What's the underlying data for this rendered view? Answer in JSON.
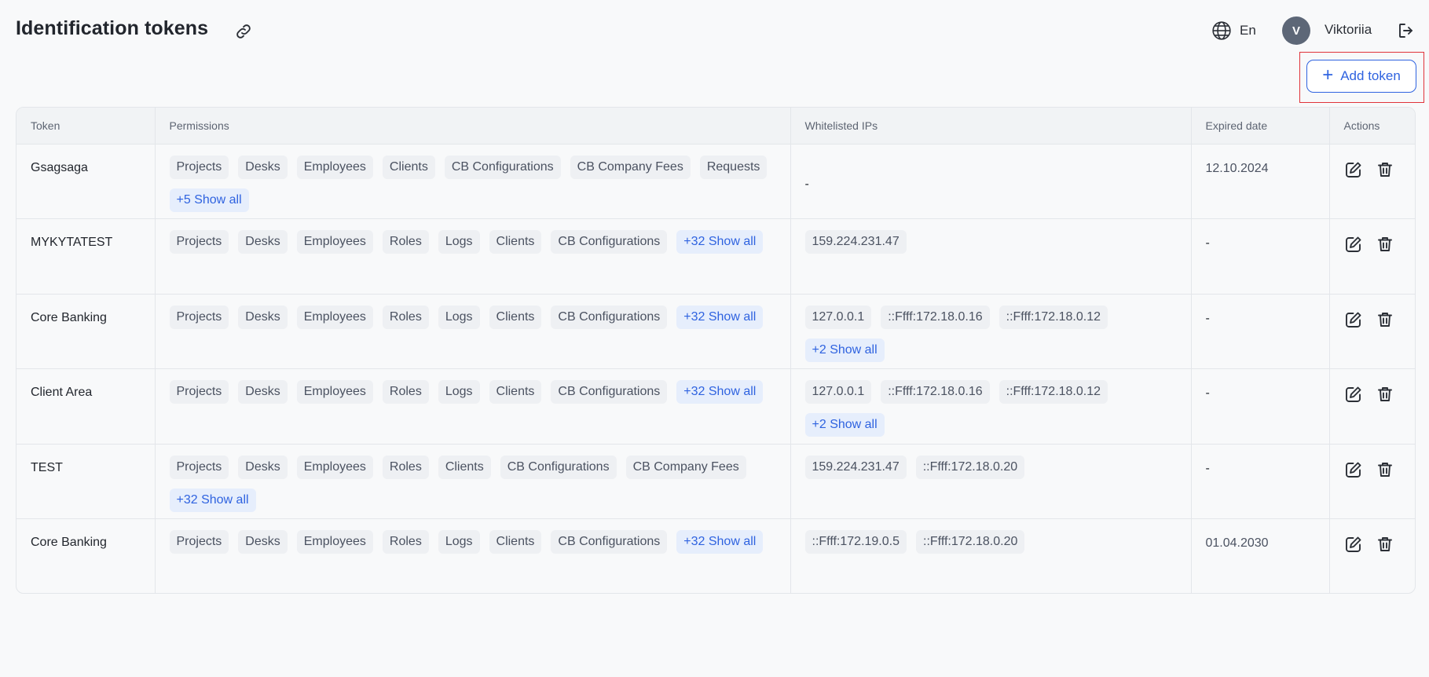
{
  "header": {
    "title": "Identification tokens",
    "language": "En",
    "user_initial": "V",
    "user_name": "Viktoriia"
  },
  "toolbar": {
    "add_label": "Add token"
  },
  "table": {
    "columns": [
      "Token",
      "Permissions",
      "Whitelisted IPs",
      "Expired date",
      "Actions"
    ],
    "rows": [
      {
        "token": "Gsagsaga",
        "permissions": [
          "Projects",
          "Desks",
          "Employees",
          "Clients",
          "CB Configurations",
          "CB Company Fees",
          "Requests"
        ],
        "permissions_more": "+5 Show all",
        "ips": [],
        "ips_empty": "-",
        "ips_more": "",
        "expired": "12.10.2024"
      },
      {
        "token": "MYKYTATEST",
        "permissions": [
          "Projects",
          "Desks",
          "Employees",
          "Roles",
          "Logs",
          "Clients",
          "CB Configurations"
        ],
        "permissions_more": "+32 Show all",
        "ips": [
          "159.224.231.47"
        ],
        "ips_empty": "",
        "ips_more": "",
        "expired": "-"
      },
      {
        "token": "Core Banking",
        "permissions": [
          "Projects",
          "Desks",
          "Employees",
          "Roles",
          "Logs",
          "Clients",
          "CB Configurations"
        ],
        "permissions_more": "+32 Show all",
        "ips": [
          "127.0.0.1",
          "::Ffff:172.18.0.16",
          "::Ffff:172.18.0.12"
        ],
        "ips_empty": "",
        "ips_more": "+2 Show all",
        "expired": "-"
      },
      {
        "token": "Client Area",
        "permissions": [
          "Projects",
          "Desks",
          "Employees",
          "Roles",
          "Logs",
          "Clients",
          "CB Configurations"
        ],
        "permissions_more": "+32 Show all",
        "ips": [
          "127.0.0.1",
          "::Ffff:172.18.0.16",
          "::Ffff:172.18.0.12"
        ],
        "ips_empty": "",
        "ips_more": "+2 Show all",
        "expired": "-"
      },
      {
        "token": "TEST",
        "permissions": [
          "Projects",
          "Desks",
          "Employees",
          "Roles",
          "Clients",
          "CB Configurations",
          "CB Company Fees"
        ],
        "permissions_more": "+32 Show all",
        "ips": [
          "159.224.231.47",
          "::Ffff:172.18.0.20"
        ],
        "ips_empty": "",
        "ips_more": "",
        "expired": "-"
      },
      {
        "token": "Core Banking",
        "permissions": [
          "Projects",
          "Desks",
          "Employees",
          "Roles",
          "Logs",
          "Clients",
          "CB Configurations"
        ],
        "permissions_more": "+32 Show all",
        "ips": [
          "::Ffff:172.19.0.5",
          "::Ffff:172.18.0.20"
        ],
        "ips_empty": "",
        "ips_more": "",
        "expired": "01.04.2030"
      }
    ]
  },
  "icons": {
    "link": "link-icon",
    "globe": "globe-icon",
    "logout": "logout-icon",
    "edit": "edit-icon",
    "delete": "trash-icon"
  },
  "colors": {
    "accent": "#2f63e0",
    "highlight": "#e0333a",
    "avatar": "#5d6777"
  }
}
